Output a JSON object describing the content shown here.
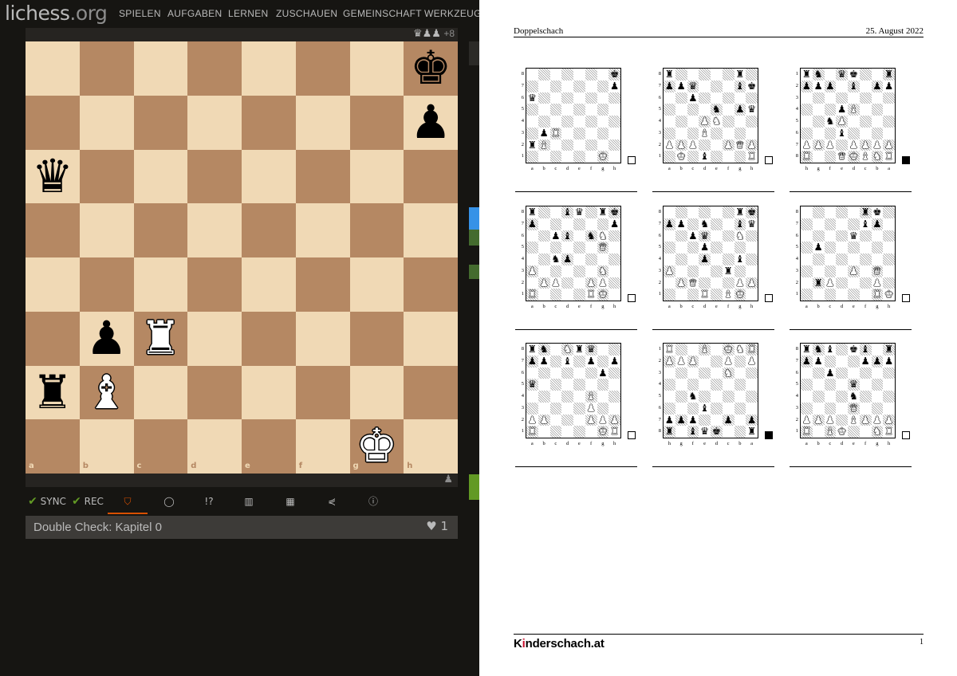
{
  "app": {
    "logo_main": "lichess",
    "logo_ext": ".org",
    "nav": [
      "SPIELEN",
      "AUFGABEN",
      "LERNEN",
      "ZUSCHAUEN",
      "GEMEINSCHAFT",
      "WERKZEUGE"
    ],
    "material": {
      "pieces": "♛♟♟",
      "diff": "+8"
    },
    "board": {
      "orientation": "white",
      "files": [
        "a",
        "b",
        "c",
        "d",
        "e",
        "f",
        "g",
        "h"
      ],
      "ranks": [
        "8",
        "7",
        "6",
        "5",
        "4",
        "3",
        "2",
        "1"
      ],
      "pieces": [
        {
          "square": "h8",
          "piece": "k"
        },
        {
          "square": "h7",
          "piece": "p"
        },
        {
          "square": "a6",
          "piece": "q"
        },
        {
          "square": "b3",
          "piece": "p"
        },
        {
          "square": "c3",
          "piece": "R"
        },
        {
          "square": "a2",
          "piece": "r"
        },
        {
          "square": "b2",
          "piece": "B"
        },
        {
          "square": "g1",
          "piece": "K"
        }
      ]
    },
    "toolbar": {
      "sync": "SYNC",
      "rec": "REC",
      "comment_glyph": "!?"
    },
    "chapter": {
      "title": "Double Check: Kapitel 0",
      "likes": "1"
    }
  },
  "document": {
    "title": "Doppelschach",
    "date": "25. August 2022",
    "brand_prefix": "K",
    "brand_i": "i",
    "brand_suffix": "nderschach.at",
    "page_number": "1",
    "diagrams": [
      {
        "flipped": false,
        "to_move": "white",
        "fen": "7k/7p/q7/8/8/1pR5/rB6/6K1"
      },
      {
        "flipped": false,
        "to_move": "white",
        "fen": "r5r1/ppq3bk/2p5/4n1pq/3PN3/3B4/PPP2PQP/1K1b3R"
      },
      {
        "flipped": true,
        "to_move": "black",
        "fen": "rn1qk2r/ppp1b1pp/8/3pB3/2nP4/3b4/PPP1PPPP/R2QKBNR"
      },
      {
        "flipped": false,
        "to_move": "white",
        "fen": "r2bq1rk/p6p/2pb1nN1/6Q1/2np4/P5N1/1PP2PP1/R4RK1"
      },
      {
        "flipped": false,
        "to_move": "white",
        "fen": "6rk/pp1n2bq/2pq2N1/3p4/3p2b1/P4r2/1PQ3PP/3R1BK1"
      },
      {
        "flipped": false,
        "to_move": "white",
        "fen": "5rk1/5bp1/4q3/1p6/8/4P1Q1/1rP3P1/6RK"
      },
      {
        "flipped": false,
        "to_move": "white",
        "fen": "rn1Nrq2/pp1b1p1p/6p1/q7/5B2/5P2/PP3PPP/R5KR"
      },
      {
        "flipped": true,
        "to_move": "black",
        "fen": "R2B1KNR/PPP2P1P/5N2/8/2n5/3b4/ppp2p1p/r1bqk2r"
      },
      {
        "flipped": false,
        "to_move": "white",
        "fen": "rnb1kb1r/pp3ppp/2p5/4q3/4n3/4Q3/PPP1BPPP/R1BK2NR"
      }
    ]
  }
}
